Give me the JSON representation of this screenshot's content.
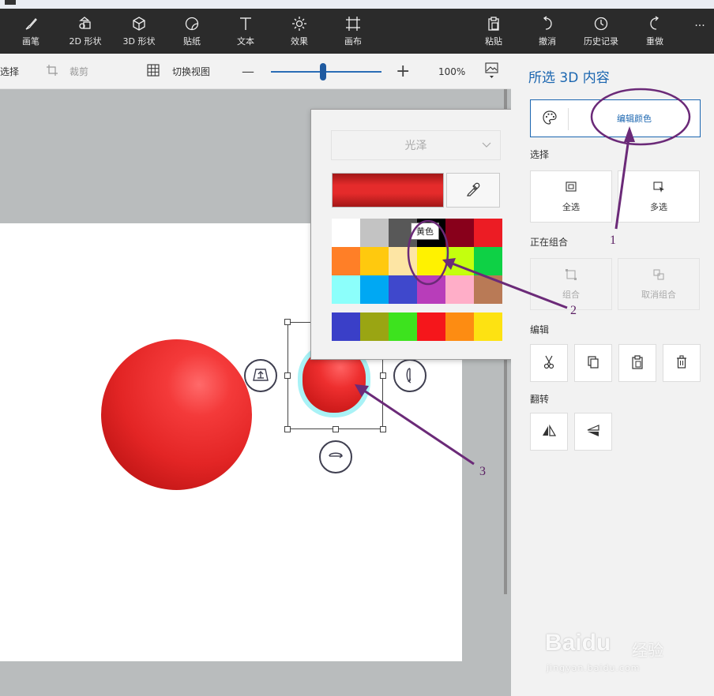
{
  "colors": {
    "toolbar_bg": "#2b2b2b",
    "accent": "#1b66b0",
    "annotation": "#6b2a78",
    "selected_color": "#e52b2b"
  },
  "toolbar": {
    "items": [
      {
        "label": "画笔",
        "icon": "brush-icon"
      },
      {
        "label": "2D 形状",
        "icon": "2d-shapes-icon"
      },
      {
        "label": "3D 形状",
        "icon": "3d-shapes-icon"
      },
      {
        "label": "贴纸",
        "icon": "stickers-icon"
      },
      {
        "label": "文本",
        "icon": "text-icon"
      },
      {
        "label": "效果",
        "icon": "effects-icon"
      },
      {
        "label": "画布",
        "icon": "canvas-icon"
      },
      {
        "label": "粘贴",
        "icon": "paste-icon"
      },
      {
        "label": "撤消",
        "icon": "undo-icon"
      },
      {
        "label": "历史记录",
        "icon": "history-icon"
      },
      {
        "label": "重做",
        "icon": "redo-icon"
      },
      {
        "label": "···",
        "icon": "more-icon"
      }
    ]
  },
  "subbar": {
    "select_label": "选择",
    "crop_label": "裁剪",
    "toggle_view_label": "切换视图",
    "zoom_minus": "—",
    "zoom_plus": "+",
    "zoom_value": "100%",
    "zoom_fraction": 0.47
  },
  "color_popup": {
    "finish_value": "光泽",
    "tooltip": "黄色",
    "palette": [
      [
        "#ffffff",
        "#c3c3c3",
        "#585858",
        "#000000",
        "#88001b",
        "#ec1c24"
      ],
      [
        "#ff7f27",
        "#ffc90e",
        "#fde5a4",
        "#fff200",
        "#c4ff0e",
        "#0ed145"
      ],
      [
        "#8cfffb",
        "#00a8f3",
        "#3f48cc",
        "#b83dba",
        "#ffaec8",
        "#b97a56"
      ]
    ],
    "custom": [
      "#3a3fc8",
      "#9aa513",
      "#3de31e",
      "#f5161b",
      "#fd8c12",
      "#fde212"
    ]
  },
  "right_panel": {
    "title": "所选 3D 内容",
    "edit_color": "编辑颜色",
    "select_section": "选择",
    "select_all": "全选",
    "multi_select": "多选",
    "group_section": "正在组合",
    "group": "组合",
    "ungroup": "取消组合",
    "edit_section": "编辑",
    "flip_section": "翻转"
  },
  "annotations": {
    "n1": "1",
    "n2": "2",
    "n3": "3"
  },
  "watermark": {
    "brand": "Baidu",
    "suffix": "经验",
    "url": "jingyan.baidu.com"
  }
}
